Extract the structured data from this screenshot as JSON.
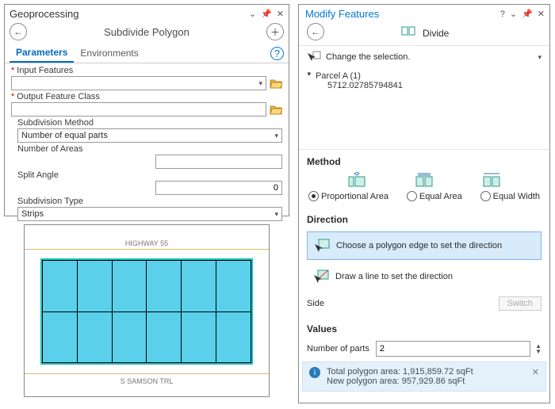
{
  "gp": {
    "panel_title": "Geoprocessing",
    "tool_title": "Subdivide Polygon",
    "tabs": {
      "t0": "Parameters",
      "t1": "Environments"
    },
    "input_features_label": "Input Features",
    "output_fc_label": "Output Feature Class",
    "sub_method_label": "Subdivision Method",
    "sub_method_value": "Number of equal parts",
    "num_areas_label": "Number of Areas",
    "split_angle_label": "Split Angle",
    "split_angle_value": "0",
    "sub_type_label": "Subdivision Type",
    "sub_type_value": "Strips",
    "help_symbol": "?"
  },
  "map": {
    "street_top": "HIGHWAY 55",
    "street_bottom": "S SAMSON TRL"
  },
  "mf": {
    "panel_title": "Modify Features",
    "tool_title": "Divide",
    "change_selection": "Change the selection.",
    "tree_parent": "Parcel A (1)",
    "tree_child": "5712.02785794841",
    "section_method": "Method",
    "radio_0": "Proportional Area",
    "radio_1": "Equal Area",
    "radio_2": "Equal Width",
    "section_direction": "Direction",
    "dir_option_0": "Choose a polygon edge to set the direction",
    "dir_option_1": "Draw a line to set the direction",
    "side_label": "Side",
    "switch_label": "Switch",
    "section_values": "Values",
    "num_parts_label": "Number of parts",
    "num_parts_value": "2",
    "info_line1": "Total polygon area: 1,915,859.72 sqFt",
    "info_line2": "New polygon area: 957,929.86 sqFt"
  }
}
